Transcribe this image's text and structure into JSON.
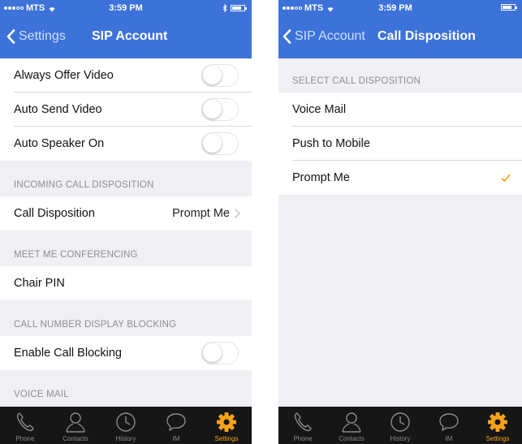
{
  "colors": {
    "nav_bar": "#3d72d9",
    "tab_bar": "#161616",
    "active_tab": "#f6a21c",
    "checkmark": "#f6a21c",
    "group_background": "#efeff4"
  },
  "left": {
    "status": {
      "carrier": "MTS",
      "time": "3:59 PM"
    },
    "nav": {
      "back_label": "Settings",
      "title": "SIP Account"
    },
    "rows": {
      "always_offer_video": {
        "label": "Always Offer Video",
        "on": false
      },
      "auto_send_video": {
        "label": "Auto Send Video",
        "on": false
      },
      "auto_speaker_on": {
        "label": "Auto Speaker On",
        "on": false
      },
      "call_disposition": {
        "label": "Call Disposition",
        "value": "Prompt Me"
      },
      "chair_pin": {
        "label": "Chair PIN"
      },
      "enable_call_blocking": {
        "label": "Enable Call Blocking",
        "on": false
      }
    },
    "sections": {
      "incoming": "INCOMING CALL DISPOSITION",
      "meet_me": "MEET ME CONFERENCING",
      "blocking": "CALL NUMBER DISPLAY BLOCKING",
      "voice_mail": "VOICE MAIL"
    }
  },
  "right": {
    "status": {
      "carrier": "MTS",
      "time": "3:59 PM"
    },
    "nav": {
      "back_label": "SIP Account",
      "title": "Call Disposition"
    },
    "section": "SELECT CALL DISPOSITION",
    "options": [
      {
        "label": "Voice Mail",
        "selected": false
      },
      {
        "label": "Push to Mobile",
        "selected": false
      },
      {
        "label": "Prompt Me",
        "selected": true
      }
    ]
  },
  "tabs": [
    {
      "label": "Phone",
      "icon": "phone-icon",
      "active": false
    },
    {
      "label": "Contacts",
      "icon": "contacts-icon",
      "active": false
    },
    {
      "label": "History",
      "icon": "history-icon",
      "active": false
    },
    {
      "label": "IM",
      "icon": "chat-bubble-icon",
      "active": false
    },
    {
      "label": "Settings",
      "icon": "gear-icon",
      "active": true
    }
  ]
}
